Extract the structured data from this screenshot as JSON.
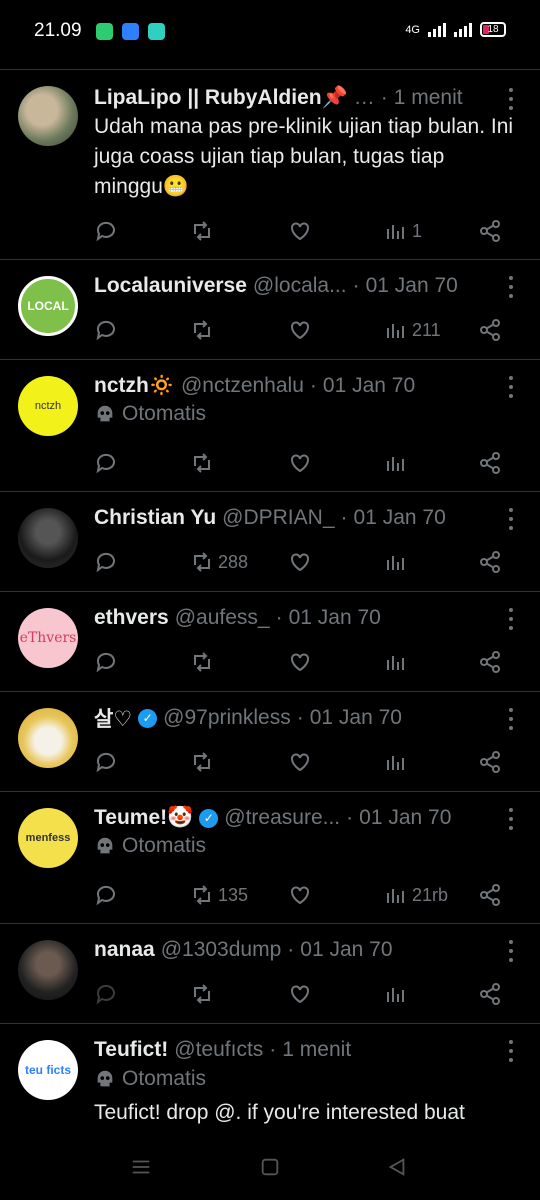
{
  "status_bar": {
    "time": "21.09",
    "network": "4G",
    "battery": "18"
  },
  "posts": [
    {
      "name": "LipaLipo || RubyAldien📌",
      "handle": "…",
      "time": "1 menit",
      "text": "Udah mana pas pre-klinik ujian tiap bulan. Ini juga coass ujian tiap bulan, tugas tiap minggu😬",
      "views": "1",
      "retweets": ""
    },
    {
      "name": "Localauniverse",
      "handle": "@locala...",
      "time": "01 Jan 70",
      "views": "211",
      "retweets": ""
    },
    {
      "name": "nctzh🔅",
      "handle": "@nctzenhalu",
      "time": "01 Jan 70",
      "label": "Otomatis",
      "views": "",
      "retweets": ""
    },
    {
      "name": "Christian Yu",
      "handle": "@DPRIAN_",
      "time": "01 Jan 70",
      "views": "",
      "retweets": "288"
    },
    {
      "name": "ethvers",
      "handle": "@aufess_",
      "time": "01 Jan 70",
      "views": "",
      "retweets": ""
    },
    {
      "name": "살♡",
      "handle": "@97prinkless",
      "time": "01 Jan 70",
      "verified": true,
      "views": "",
      "retweets": ""
    },
    {
      "name": "Teume!🤡",
      "handle": "@treasure...",
      "time": "01 Jan 70",
      "verified": true,
      "label": "Otomatis",
      "views": "21rb",
      "retweets": "135"
    },
    {
      "name": "nanaa",
      "handle": "@1303dump",
      "time": "01 Jan 70",
      "views": "",
      "retweets": ""
    },
    {
      "name": "Teufict!",
      "handle": "@teufıcts",
      "time": "1 menit",
      "label": "Otomatis",
      "text": "Teufict! drop @. if you're interested buat"
    }
  ],
  "avatars": {
    "post_1": "photo-avatar",
    "post_2": "localauniverse-logo",
    "post_3_text": "nctzh",
    "post_5_text": "eThvers",
    "post_7_text": "menfess",
    "post_9_text": "teu ficts"
  },
  "colors": {
    "background": "#000000",
    "text": "#e7e9ea",
    "muted": "#71767b",
    "divider": "#2f3336",
    "verified": "#1d9bf0"
  }
}
